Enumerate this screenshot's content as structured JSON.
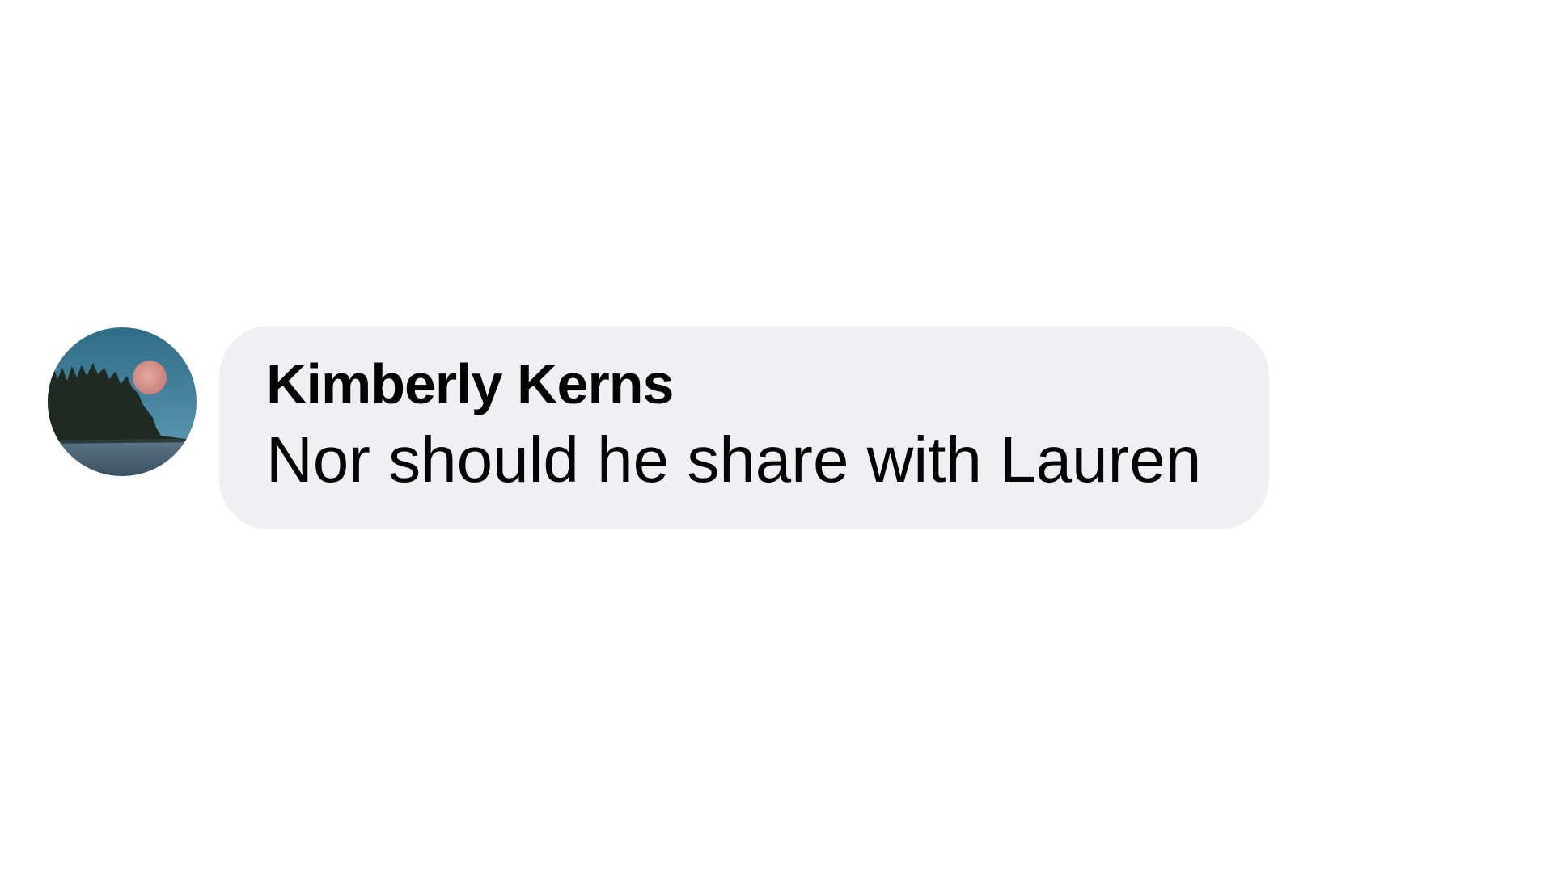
{
  "comment": {
    "author_name": "Kimberly Kerns",
    "text": "Nor should he share with Lauren",
    "avatar_icon": "moon-over-island-avatar"
  },
  "colors": {
    "page_background": "#ffffff",
    "bubble_background": "#eff0f4",
    "text": "#050505"
  }
}
